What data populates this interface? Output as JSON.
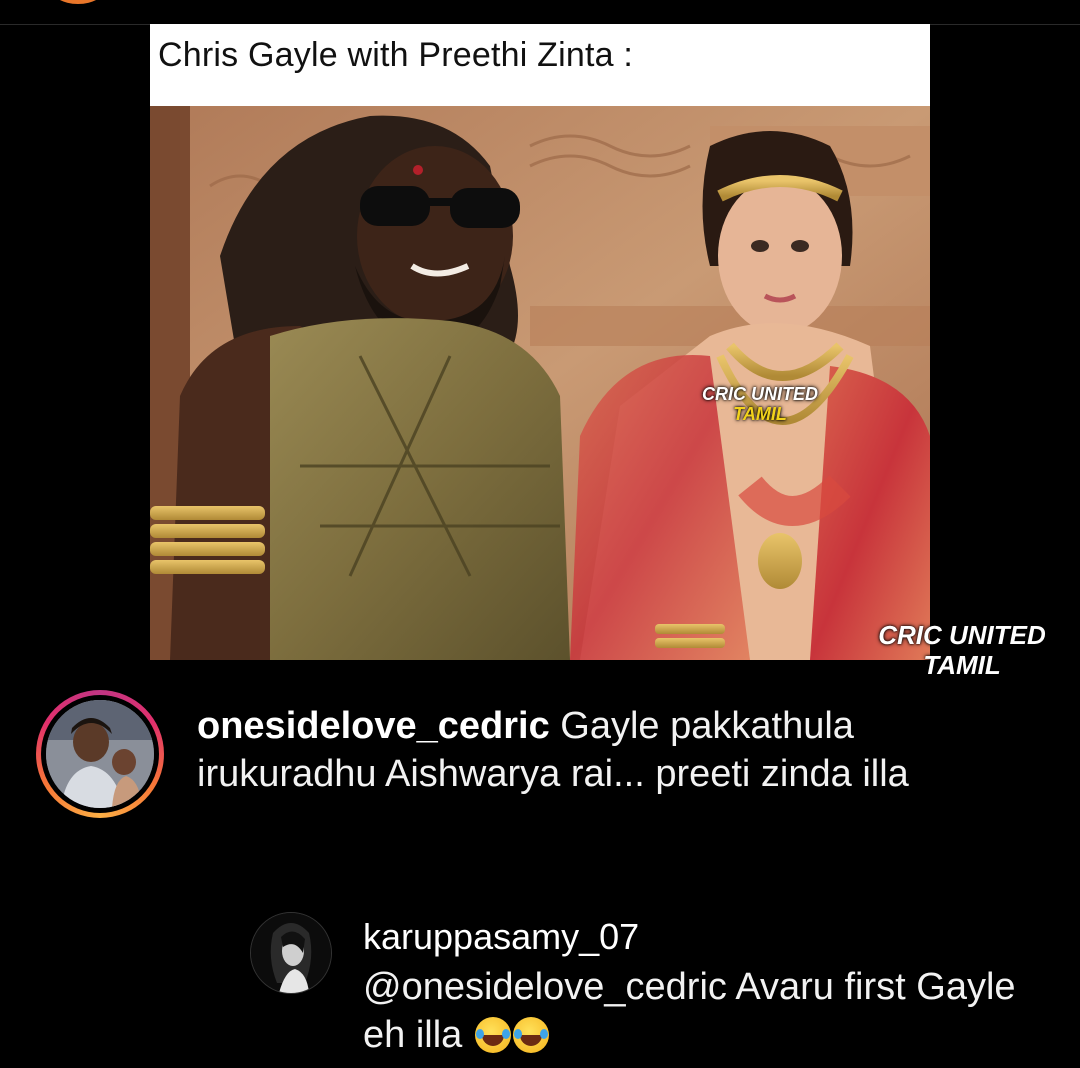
{
  "meme": {
    "caption": "Chris Gayle with Preethi Zinta :",
    "watermark_line1": "CRIC UNITED",
    "watermark_line2": "TAMIL"
  },
  "comment": {
    "username": "onesidelove_cedric",
    "text": " Gayle pakkathula irukuradhu Aishwarya rai... preeti zinda illa"
  },
  "reply": {
    "username": "karuppasamy_07",
    "text": "@onesidelove_cedric Avaru first Gayle eh illa"
  },
  "colors": {
    "background": "#000000",
    "accent_orange": "#e8762a",
    "watermark_yellow": "#f2d21b"
  }
}
